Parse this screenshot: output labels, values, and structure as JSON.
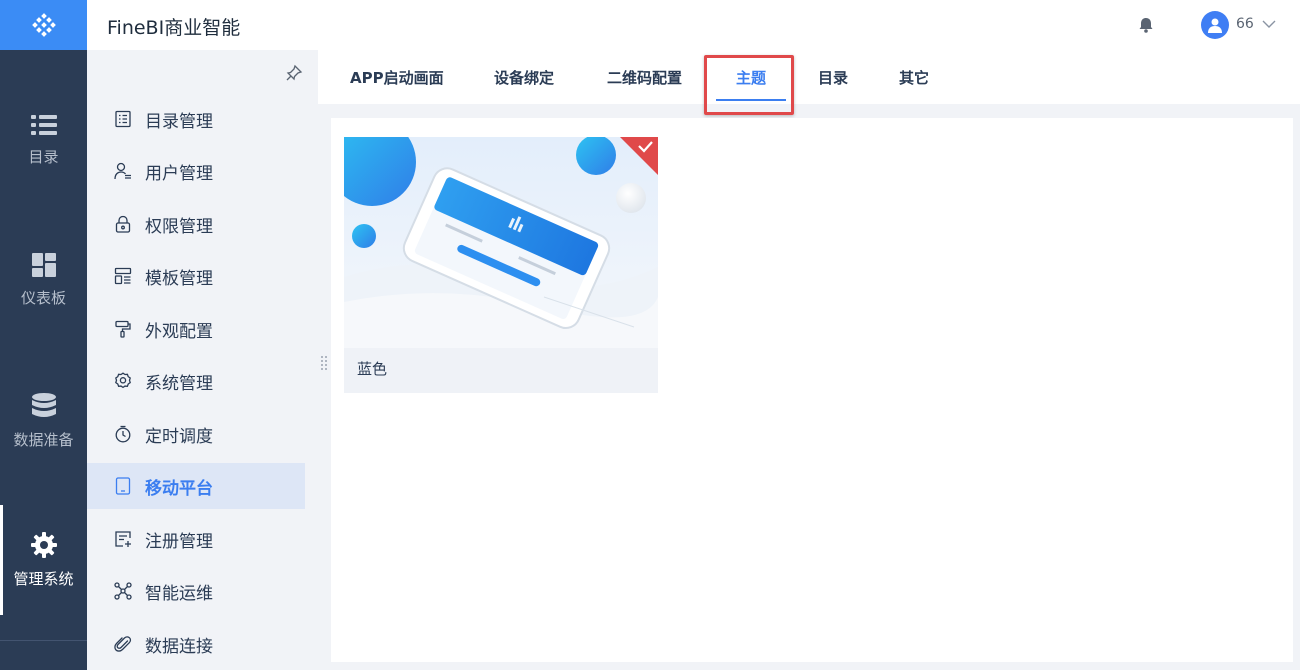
{
  "app": {
    "title": "FineBI商业智能",
    "brand_color": "#3b8cf5",
    "rail_color": "#2b3c55",
    "logo_icon": "diamond-logo-icon"
  },
  "rail": {
    "items": [
      {
        "label": "目录",
        "icon": "list-icon",
        "active": false
      },
      {
        "label": "仪表板",
        "icon": "dashboard-icon",
        "active": false
      },
      {
        "label": "数据准备",
        "icon": "database-icon",
        "active": false
      },
      {
        "label": "管理系统",
        "icon": "gear-icon",
        "active": true
      }
    ]
  },
  "header": {
    "notification_icon": "bell-icon",
    "user": {
      "name": "66",
      "avatar_icon": "user-avatar-icon"
    }
  },
  "submenu": {
    "pin_icon": "pin-icon",
    "items": [
      {
        "label": "目录管理",
        "icon": "catalog-icon",
        "active": false
      },
      {
        "label": "用户管理",
        "icon": "user-manage-icon",
        "active": false
      },
      {
        "label": "权限管理",
        "icon": "lock-icon",
        "active": false
      },
      {
        "label": "模板管理",
        "icon": "template-icon",
        "active": false
      },
      {
        "label": "外观配置",
        "icon": "paint-roller-icon",
        "active": false
      },
      {
        "label": "系统管理",
        "icon": "settings-icon",
        "active": false
      },
      {
        "label": "定时调度",
        "icon": "timer-icon",
        "active": false
      },
      {
        "label": "移动平台",
        "icon": "tablet-icon",
        "active": true
      },
      {
        "label": "注册管理",
        "icon": "register-icon",
        "active": false
      },
      {
        "label": "智能运维",
        "icon": "network-icon",
        "active": false
      },
      {
        "label": "数据连接",
        "icon": "paperclip-icon",
        "active": false
      }
    ]
  },
  "tabs": {
    "items": [
      {
        "label": "APP启动画面",
        "active": false
      },
      {
        "label": "设备绑定",
        "active": false
      },
      {
        "label": "二维码配置",
        "active": false
      },
      {
        "label": "主题",
        "active": true
      },
      {
        "label": "目录",
        "active": false
      },
      {
        "label": "其它",
        "active": false
      }
    ],
    "highlight_color": "#e0494a"
  },
  "themes": {
    "cards": [
      {
        "label": "蓝色",
        "selected": true,
        "check_icon": "check-icon",
        "badge_color": "#e0494a"
      }
    ]
  }
}
